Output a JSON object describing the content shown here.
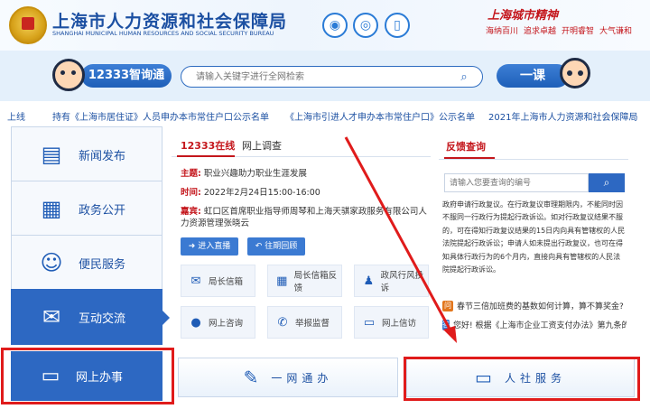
{
  "header": {
    "title": "上海市人力资源和社会保障局",
    "subtitle": "SHANGHAI MUNICIPAL HUMAN RESOURCES AND SOCIAL SECURITY BUREAU",
    "social_icons": [
      "weibo-icon",
      "wechat-icon",
      "mobile-icon"
    ],
    "city_spirit_title": "上海城市精神",
    "slogans": [
      "海纳百川",
      "追求卓越",
      "开明睿智",
      "大气谦和"
    ]
  },
  "search": {
    "assistant_label": "12333智询通",
    "placeholder": "请输入关键字进行全网检索",
    "yike_label": "一课"
  },
  "ticker": {
    "items": [
      "上线",
      "持有《上海市居住证》人员申办本市常住户口公示名单",
      "《上海市引进人才申办本市常住户口》公示名单",
      "2021年上海市人力资源和社会保障局"
    ]
  },
  "nav": {
    "items": [
      {
        "label": "新闻发布",
        "icon": "newspaper-icon"
      },
      {
        "label": "政务公开",
        "icon": "document-icon"
      },
      {
        "label": "便民服务",
        "icon": "people-icon"
      },
      {
        "label": "互动交流",
        "icon": "chat-icon"
      }
    ],
    "bottom": {
      "label": "网上办事",
      "icon": "monitor-icon"
    }
  },
  "center": {
    "tabs": [
      "12333在线",
      "网上调查"
    ],
    "topic_key": "主题:",
    "topic_value": "职业兴趣助力职业生涯发展",
    "time_key": "时间:",
    "time_value": "2022年2月24日15:00-16:00",
    "guest_key": "嘉宾:",
    "guest_value": "虹口区首席职业指导师周琴和上海天骐家政服务有限公司人力资源管理张晓云",
    "enter_live": "进入直播",
    "past_issues": "往期回顾",
    "tiles": [
      {
        "label": "局长信箱",
        "icon": "mail-icon"
      },
      {
        "label": "局长信箱反馈",
        "icon": "grid-icon"
      },
      {
        "label": "政风行风投诉",
        "icon": "person-icon"
      },
      {
        "label": "网上咨询",
        "icon": "chat-bubble-icon"
      },
      {
        "label": "举报监督",
        "icon": "phone-icon"
      },
      {
        "label": "网上信访",
        "icon": "screen-icon"
      }
    ]
  },
  "feedback": {
    "title": "反馈查询",
    "placeholder": "请输入您要查询的编号",
    "description": "政府申请行政复议。在行政复议审理期限内，不能同时因不服同一行政行为提起行政诉讼。如对行政复议结果不服的，可在得知行政复议结果的15日内向具有管辖权的人民法院提起行政诉讼；申请人如未提出行政复议，也可在得知具体行政行为的6个月内，直接向具有管辖权的人民法院提起行政诉讼。",
    "qa": [
      {
        "badge": "问",
        "text": "春节三倍加班费的基数如何计算，算不算奖金?",
        "color": "#e2761d"
      },
      {
        "badge": "答",
        "text": "您好! 根据《上海市企业工资支付办法》第九条的",
        "color": "#3b7ad2"
      }
    ]
  },
  "banners": [
    {
      "label": "一网通办",
      "icon": "edit-icon"
    },
    {
      "label": "人社服务",
      "icon": "monitor-icon"
    }
  ]
}
